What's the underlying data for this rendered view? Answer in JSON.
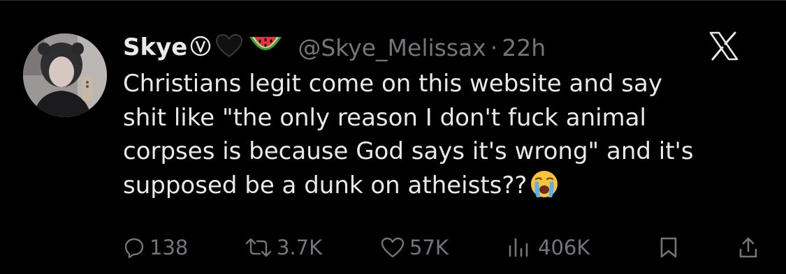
{
  "tweet": {
    "author_name": "Skye",
    "name_badges": [
      "circled-v-emoji",
      "black-heart-emoji",
      "watermelon-emoji"
    ],
    "handle": "@Skye_Melissax",
    "separator": "·",
    "time": "22h",
    "text_lines": [
      "Christians legit come on this website and say",
      "shit like \"the only reason I don't fuck animal",
      "corpses is because God says it's wrong\" and it's",
      "supposed be a dunk on atheists??"
    ],
    "trailing_emoji": "loudly-crying-face-emoji"
  },
  "actions": {
    "replies": "138",
    "reposts": "3.7K",
    "likes": "57K",
    "views": "406K"
  },
  "colors": {
    "background": "#000000",
    "text": "#e7e9ea",
    "muted": "#71767b"
  },
  "icons": [
    "avatar",
    "x-logo-icon",
    "reply-icon",
    "repost-icon",
    "like-icon",
    "views-icon",
    "bookmark-icon",
    "share-icon"
  ]
}
